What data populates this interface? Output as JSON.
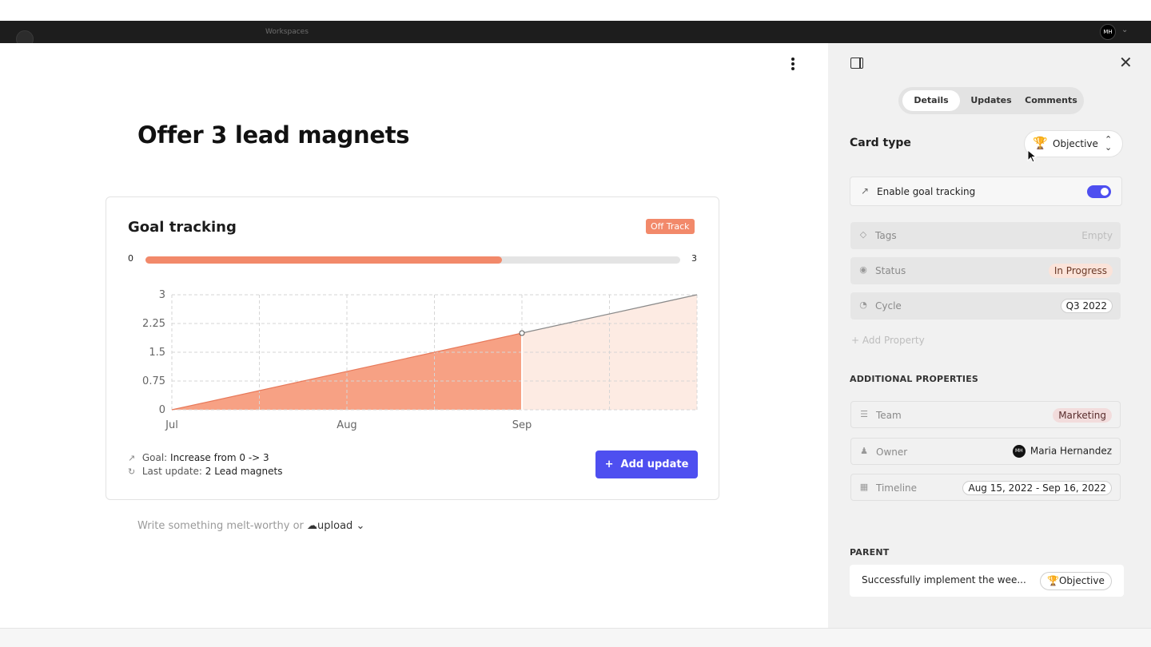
{
  "app": {
    "workspace": "Workspaces",
    "user_initials": "MH"
  },
  "document": {
    "title": "Offer 3 lead magnets",
    "compose_placeholder": "Write something melt-worthy or",
    "compose_upload": "upload"
  },
  "goal": {
    "heading": "Goal tracking",
    "status_badge": "Off Track",
    "progress_min": "0",
    "progress_max": "3",
    "progress_fraction": 0.667,
    "goal_label": "Goal:",
    "goal_value": "Increase from 0 -> 3",
    "last_update_label": "Last update:",
    "last_update_value": "2 Lead magnets",
    "add_update_label": "Add update"
  },
  "chart_data": {
    "type": "area",
    "y_ticks": [
      "3",
      "2.25",
      "1.5",
      "0.75",
      "0"
    ],
    "x_ticks": [
      "Jul",
      "Aug",
      "Sep"
    ],
    "ylim": [
      0,
      3
    ],
    "xlim": [
      0,
      3
    ],
    "actual": [
      {
        "x": 0,
        "y": 0
      },
      {
        "x": 2,
        "y": 2
      }
    ],
    "target": [
      {
        "x": 2,
        "y": 2
      },
      {
        "x": 3,
        "y": 3
      }
    ],
    "colors": {
      "actual": "#f7a184",
      "target": "#fdebe3",
      "line": "#8a8a8a"
    }
  },
  "panel": {
    "tabs": [
      {
        "label": "Details",
        "active": true
      },
      {
        "label": "Updates",
        "active": false
      },
      {
        "label": "Comments",
        "active": false
      }
    ],
    "card_type_label": "Card type",
    "card_type_value": "Objective",
    "goal_tracking_label": "Enable goal tracking",
    "goal_tracking_on": true,
    "properties": [
      {
        "label": "Tags",
        "value": "Empty"
      },
      {
        "label": "Status",
        "value": "In Progress"
      },
      {
        "label": "Cycle",
        "value": "Q3 2022"
      }
    ],
    "add_property": "Add Property",
    "additional_heading": "ADDITIONAL PROPERTIES",
    "additional": [
      {
        "label": "Team",
        "value": "Marketing"
      },
      {
        "label": "Owner",
        "value": "Maria Hernandez"
      },
      {
        "label": "Timeline",
        "value": "Aug 15, 2022 - Sep 16, 2022"
      }
    ],
    "parent_heading": "PARENT",
    "parent_title": "Successfully implement the wee...",
    "parent_type": "Objective"
  },
  "colors": {
    "accent": "#4e4ff0",
    "off_track": "#f2896a"
  }
}
